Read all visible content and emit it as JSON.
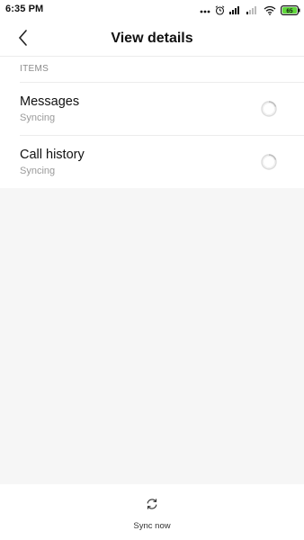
{
  "status_bar": {
    "time": "6:35 PM",
    "icons": [
      "more-dots-icon",
      "alarm-icon",
      "signal-icon",
      "signal-weak-icon",
      "wifi-icon",
      "battery-icon"
    ],
    "battery_level": "65",
    "battery_color": "#5fd93a"
  },
  "header": {
    "title": "View details",
    "back_icon": "chevron-left-icon"
  },
  "section": {
    "label": "ITEMS"
  },
  "items": [
    {
      "title": "Messages",
      "status": "Syncing",
      "icon": "loading-spinner-icon"
    },
    {
      "title": "Call history",
      "status": "Syncing",
      "icon": "loading-spinner-icon"
    }
  ],
  "footer": {
    "sync_label": "Sync now",
    "sync_icon": "refresh-icon"
  }
}
